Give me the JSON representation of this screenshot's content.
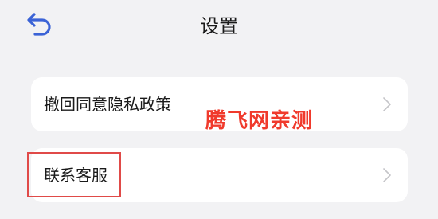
{
  "header": {
    "title": "设置",
    "back_icon": "back-arrow-icon",
    "accent_color": "#3b63d6"
  },
  "menu": {
    "items": [
      {
        "label": "撤回同意隐私政策",
        "icon": "chevron-right-icon"
      },
      {
        "label": "联系客服",
        "icon": "chevron-right-icon"
      }
    ]
  },
  "annotation": {
    "watermark_text": "腾飞网亲测",
    "watermark_color": "#f03a2c",
    "highlight_color": "#e04a48"
  }
}
